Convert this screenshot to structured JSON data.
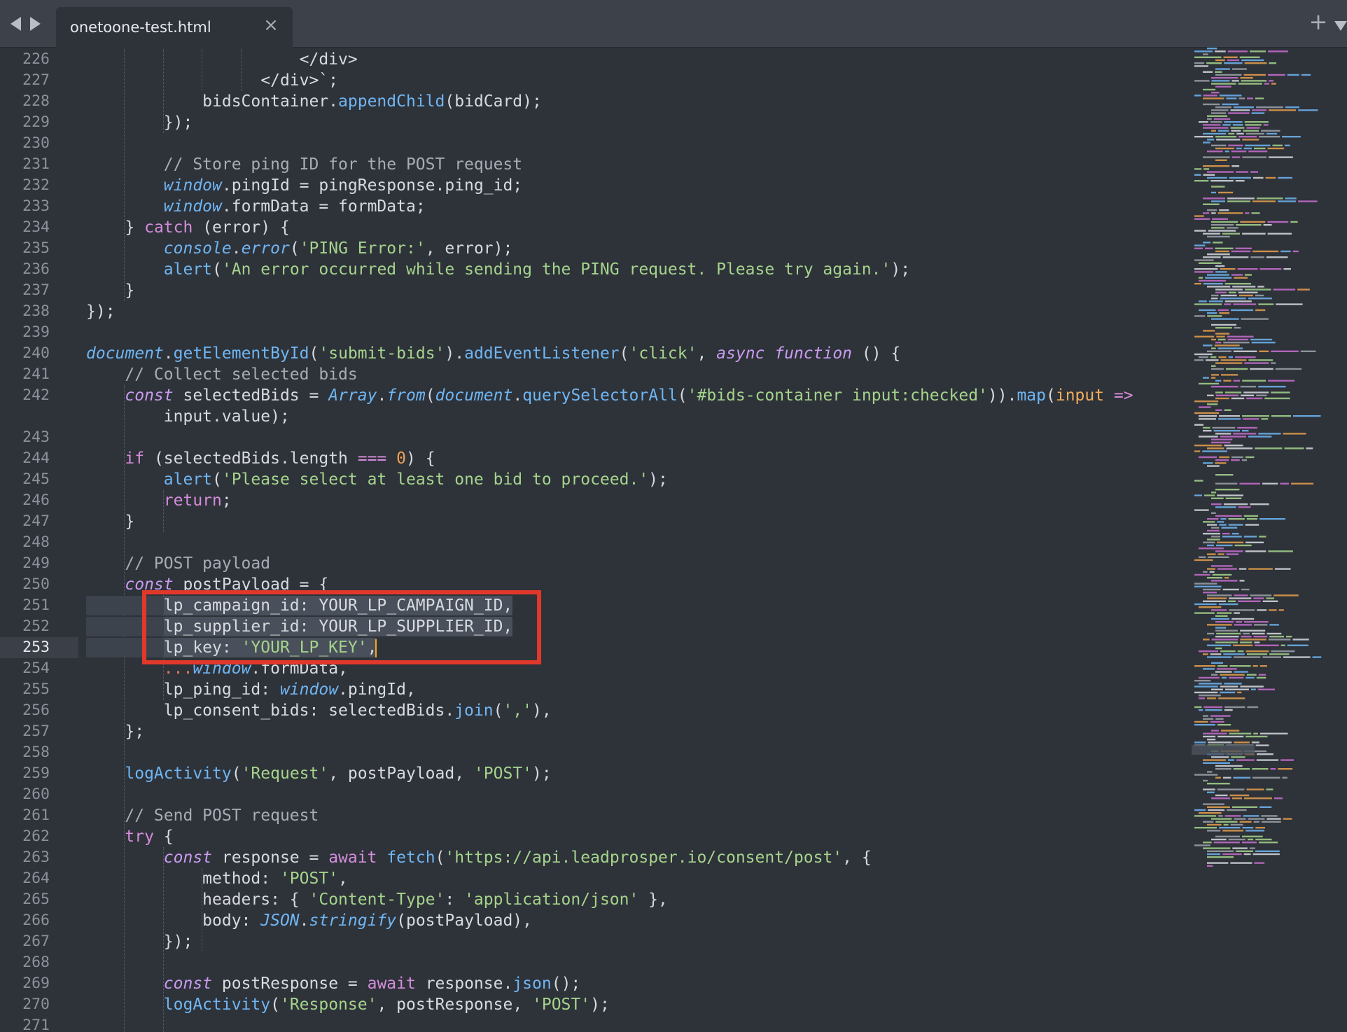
{
  "tabbar": {
    "back_icon": "triangle-left",
    "forward_icon": "triangle-right",
    "tab": {
      "title": "onetoone-test.html",
      "close_glyph": "×"
    },
    "new_tab_glyph": "+",
    "menu_icon": "triangle-down"
  },
  "editor": {
    "current_line": 253,
    "highlight_color": "#e2382b",
    "lines": [
      {
        "n": 226,
        "indent": 0,
        "tokens": [
          [
            "ind",
            "                      "
          ],
          [
            "p",
            "</div>"
          ]
        ]
      },
      {
        "n": 227,
        "indent": 0,
        "tokens": [
          [
            "ind",
            "                  "
          ],
          [
            "p",
            "</div>`;"
          ]
        ]
      },
      {
        "n": 228,
        "indent": 0,
        "tokens": [
          [
            "ind",
            "            "
          ],
          [
            "p",
            "bidsContainer."
          ],
          [
            "fn",
            "appendChild"
          ],
          [
            "p",
            "(bidCard);"
          ]
        ]
      },
      {
        "n": 229,
        "indent": 0,
        "tokens": [
          [
            "ind",
            "        "
          ],
          [
            "p",
            "});"
          ]
        ]
      },
      {
        "n": 230,
        "indent": 0,
        "tokens": []
      },
      {
        "n": 231,
        "indent": 0,
        "tokens": [
          [
            "ind",
            "        "
          ],
          [
            "cmt",
            "// Store ping ID for the POST request"
          ]
        ]
      },
      {
        "n": 232,
        "indent": 0,
        "tokens": [
          [
            "ind",
            "        "
          ],
          [
            "obj",
            "window"
          ],
          [
            "p",
            ".pingId = pingResponse.ping_id;"
          ]
        ]
      },
      {
        "n": 233,
        "indent": 0,
        "tokens": [
          [
            "ind",
            "        "
          ],
          [
            "obj",
            "window"
          ],
          [
            "p",
            ".formData = formData;"
          ]
        ]
      },
      {
        "n": 234,
        "indent": 0,
        "tokens": [
          [
            "ind",
            "    "
          ],
          [
            "p",
            "} "
          ],
          [
            "ctl",
            "catch"
          ],
          [
            "p",
            " (error) {"
          ]
        ]
      },
      {
        "n": 235,
        "indent": 0,
        "tokens": [
          [
            "ind",
            "        "
          ],
          [
            "obj",
            "console"
          ],
          [
            "p",
            "."
          ],
          [
            "obj",
            "error"
          ],
          [
            "p",
            "("
          ],
          [
            "str",
            "'PING Error:'"
          ],
          [
            "p",
            ", error);"
          ]
        ]
      },
      {
        "n": 236,
        "indent": 0,
        "tokens": [
          [
            "ind",
            "        "
          ],
          [
            "fn",
            "alert"
          ],
          [
            "p",
            "("
          ],
          [
            "str",
            "'An error occurred while sending the PING request. Please try again.'"
          ],
          [
            "p",
            ");"
          ]
        ]
      },
      {
        "n": 237,
        "indent": 0,
        "tokens": [
          [
            "ind",
            "    "
          ],
          [
            "p",
            "}"
          ]
        ]
      },
      {
        "n": 238,
        "indent": 0,
        "tokens": [
          [
            "p",
            "});"
          ]
        ]
      },
      {
        "n": 239,
        "indent": 0,
        "tokens": []
      },
      {
        "n": 240,
        "indent": 0,
        "tokens": [
          [
            "obj",
            "document"
          ],
          [
            "p",
            "."
          ],
          [
            "fn",
            "getElementById"
          ],
          [
            "p",
            "("
          ],
          [
            "str",
            "'submit-bids'"
          ],
          [
            "p",
            ")."
          ],
          [
            "fn",
            "addEventListener"
          ],
          [
            "p",
            "("
          ],
          [
            "str",
            "'click'"
          ],
          [
            "p",
            ", "
          ],
          [
            "kw",
            "async function"
          ],
          [
            "p",
            " () {"
          ]
        ]
      },
      {
        "n": 241,
        "indent": 0,
        "tokens": [
          [
            "ind",
            "    "
          ],
          [
            "cmt",
            "// Collect selected bids"
          ]
        ]
      },
      {
        "n": 242,
        "indent": 0,
        "tokens": [
          [
            "ind",
            "    "
          ],
          [
            "kw",
            "const"
          ],
          [
            "p",
            " selectedBids = "
          ],
          [
            "obj",
            "Array"
          ],
          [
            "p",
            "."
          ],
          [
            "obj",
            "from"
          ],
          [
            "p",
            "("
          ],
          [
            "obj",
            "document"
          ],
          [
            "p",
            "."
          ],
          [
            "fn",
            "querySelectorAll"
          ],
          [
            "p",
            "("
          ],
          [
            "str",
            "'#bids-container input:checked'"
          ],
          [
            "p",
            "))."
          ],
          [
            "fn",
            "map"
          ],
          [
            "p",
            "("
          ],
          [
            "arg",
            "input"
          ],
          [
            "p",
            " "
          ],
          [
            "ctl",
            "=>"
          ]
        ]
      },
      {
        "n": null,
        "indent": 0,
        "tokens": [
          [
            "ind",
            "        "
          ],
          [
            "p",
            "input.value);"
          ]
        ]
      },
      {
        "n": 243,
        "indent": 0,
        "tokens": []
      },
      {
        "n": 244,
        "indent": 0,
        "tokens": [
          [
            "ind",
            "    "
          ],
          [
            "ctl",
            "if"
          ],
          [
            "p",
            " (selectedBids.length "
          ],
          [
            "ctl",
            "==="
          ],
          [
            "p",
            " "
          ],
          [
            "num",
            "0"
          ],
          [
            "p",
            ") {"
          ]
        ]
      },
      {
        "n": 245,
        "indent": 0,
        "tokens": [
          [
            "ind",
            "        "
          ],
          [
            "fn",
            "alert"
          ],
          [
            "p",
            "("
          ],
          [
            "str",
            "'Please select at least one bid to proceed.'"
          ],
          [
            "p",
            ");"
          ]
        ]
      },
      {
        "n": 246,
        "indent": 0,
        "tokens": [
          [
            "ind",
            "        "
          ],
          [
            "ctl",
            "return"
          ],
          [
            "p",
            ";"
          ]
        ]
      },
      {
        "n": 247,
        "indent": 0,
        "tokens": [
          [
            "ind",
            "    "
          ],
          [
            "p",
            "}"
          ]
        ]
      },
      {
        "n": 248,
        "indent": 0,
        "tokens": []
      },
      {
        "n": 249,
        "indent": 0,
        "tokens": [
          [
            "ind",
            "    "
          ],
          [
            "cmt",
            "// POST payload"
          ]
        ]
      },
      {
        "n": 250,
        "indent": 0,
        "tokens": [
          [
            "ind",
            "    "
          ],
          [
            "kw",
            "const"
          ],
          [
            "p",
            " postPayload = {"
          ]
        ]
      },
      {
        "n": 251,
        "indent": 0,
        "tokens": [
          [
            "ind",
            "        "
          ],
          [
            "p",
            "lp_campaign_id: YOUR_LP_CAMPAIGN_ID,"
          ]
        ]
      },
      {
        "n": 252,
        "indent": 0,
        "tokens": [
          [
            "ind",
            "        "
          ],
          [
            "p",
            "lp_supplier_id: YOUR_LP_SUPPLIER_ID,"
          ]
        ]
      },
      {
        "n": 253,
        "indent": 0,
        "tokens": [
          [
            "ind",
            "        "
          ],
          [
            "p",
            "lp_key: "
          ],
          [
            "str",
            "'YOUR_LP_KEY'"
          ],
          [
            "p",
            ","
          ],
          [
            "cur",
            ""
          ]
        ]
      },
      {
        "n": 254,
        "indent": 0,
        "tokens": [
          [
            "ind",
            "        "
          ],
          [
            "spr",
            "..."
          ],
          [
            "obj",
            "window"
          ],
          [
            "p",
            ".formData,"
          ]
        ]
      },
      {
        "n": 255,
        "indent": 0,
        "tokens": [
          [
            "ind",
            "        "
          ],
          [
            "p",
            "lp_ping_id: "
          ],
          [
            "obj",
            "window"
          ],
          [
            "p",
            ".pingId,"
          ]
        ]
      },
      {
        "n": 256,
        "indent": 0,
        "tokens": [
          [
            "ind",
            "        "
          ],
          [
            "p",
            "lp_consent_bids: selectedBids."
          ],
          [
            "fn",
            "join"
          ],
          [
            "p",
            "("
          ],
          [
            "str",
            "','"
          ],
          [
            "p",
            "),"
          ]
        ]
      },
      {
        "n": 257,
        "indent": 0,
        "tokens": [
          [
            "ind",
            "    "
          ],
          [
            "p",
            "};"
          ]
        ]
      },
      {
        "n": 258,
        "indent": 0,
        "tokens": []
      },
      {
        "n": 259,
        "indent": 0,
        "tokens": [
          [
            "ind",
            "    "
          ],
          [
            "fn",
            "logActivity"
          ],
          [
            "p",
            "("
          ],
          [
            "str",
            "'Request'"
          ],
          [
            "p",
            ", postPayload, "
          ],
          [
            "str",
            "'POST'"
          ],
          [
            "p",
            ");"
          ]
        ]
      },
      {
        "n": 260,
        "indent": 0,
        "tokens": []
      },
      {
        "n": 261,
        "indent": 0,
        "tokens": [
          [
            "ind",
            "    "
          ],
          [
            "cmt",
            "// Send POST request"
          ]
        ]
      },
      {
        "n": 262,
        "indent": 0,
        "tokens": [
          [
            "ind",
            "    "
          ],
          [
            "ctl",
            "try"
          ],
          [
            "p",
            " {"
          ]
        ]
      },
      {
        "n": 263,
        "indent": 0,
        "tokens": [
          [
            "ind",
            "        "
          ],
          [
            "kw",
            "const"
          ],
          [
            "p",
            " response = "
          ],
          [
            "ctl",
            "await"
          ],
          [
            "p",
            " "
          ],
          [
            "fn",
            "fetch"
          ],
          [
            "p",
            "("
          ],
          [
            "str",
            "'https://api.leadprosper.io/consent/post'"
          ],
          [
            "p",
            ", {"
          ]
        ]
      },
      {
        "n": 264,
        "indent": 0,
        "tokens": [
          [
            "ind",
            "            "
          ],
          [
            "p",
            "method: "
          ],
          [
            "str",
            "'POST'"
          ],
          [
            "p",
            ","
          ]
        ]
      },
      {
        "n": 265,
        "indent": 0,
        "tokens": [
          [
            "ind",
            "            "
          ],
          [
            "p",
            "headers: { "
          ],
          [
            "str",
            "'Content-Type'"
          ],
          [
            "p",
            ": "
          ],
          [
            "str",
            "'application/json'"
          ],
          [
            "p",
            " },"
          ]
        ]
      },
      {
        "n": 266,
        "indent": 0,
        "tokens": [
          [
            "ind",
            "            "
          ],
          [
            "p",
            "body: "
          ],
          [
            "obj",
            "JSON"
          ],
          [
            "p",
            "."
          ],
          [
            "obj",
            "stringify"
          ],
          [
            "p",
            "(postPayload),"
          ]
        ]
      },
      {
        "n": 267,
        "indent": 0,
        "tokens": [
          [
            "ind",
            "        "
          ],
          [
            "p",
            "});"
          ]
        ]
      },
      {
        "n": 268,
        "indent": 0,
        "tokens": []
      },
      {
        "n": 269,
        "indent": 0,
        "tokens": [
          [
            "ind",
            "        "
          ],
          [
            "kw",
            "const"
          ],
          [
            "p",
            " postResponse = "
          ],
          [
            "ctl",
            "await"
          ],
          [
            "p",
            " response."
          ],
          [
            "fn",
            "json"
          ],
          [
            "p",
            "();"
          ]
        ]
      },
      {
        "n": 270,
        "indent": 0,
        "tokens": [
          [
            "ind",
            "        "
          ],
          [
            "fn",
            "logActivity"
          ],
          [
            "p",
            "("
          ],
          [
            "str",
            "'Response'"
          ],
          [
            "p",
            ", postResponse, "
          ],
          [
            "str",
            "'POST'"
          ],
          [
            "p",
            ");"
          ]
        ]
      },
      {
        "n": 271,
        "indent": 0,
        "tokens": []
      }
    ]
  },
  "minimap": {
    "visible": true
  }
}
